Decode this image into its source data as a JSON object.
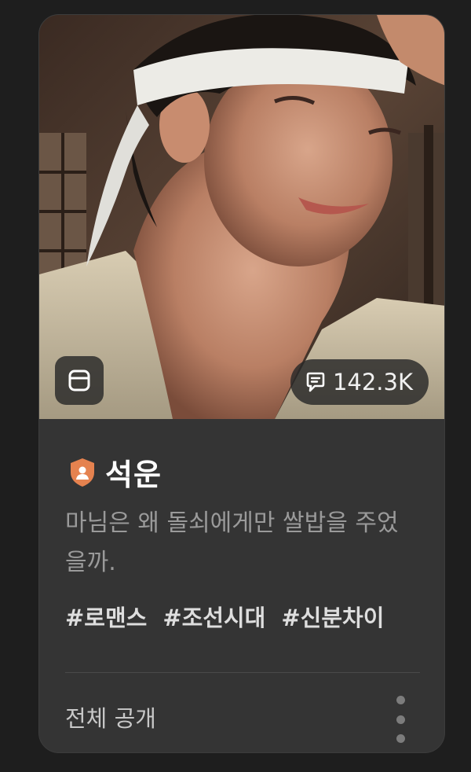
{
  "character": {
    "name": "석운",
    "description": "마님은 왜 돌쇠에게만 쌀밥을 주었을까.",
    "tags": [
      "#로맨스",
      "#조선시대",
      "#신분차이"
    ],
    "chat_count": "142.3K",
    "visibility": "전체 공개"
  },
  "icons": {
    "cover_badge": "window-icon",
    "chat": "chat-bubble-icon",
    "creator_badge": "shield-person-icon",
    "more": "more-vertical-icon"
  },
  "colors": {
    "badge_accent": "#e5824f",
    "card_bg": "#343434",
    "page_bg": "#1e1e1e"
  }
}
